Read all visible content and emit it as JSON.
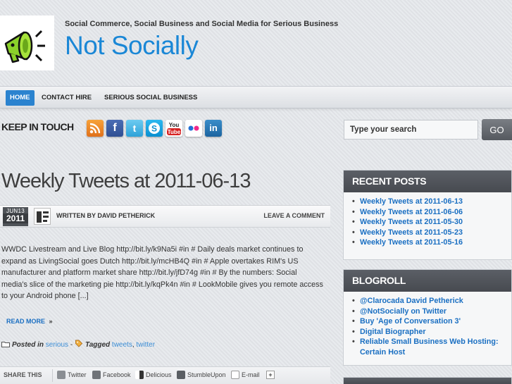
{
  "header": {
    "tagline": "Social Commerce, Social Business and Social Media for Serious Business",
    "site_title": "Not Socially"
  },
  "nav": {
    "items": [
      {
        "label": "HOME"
      },
      {
        "label": "CONTACT HIRE"
      },
      {
        "label": "SERIOUS SOCIAL BUSINESS"
      }
    ]
  },
  "keep_in_touch": {
    "label": "KEEP IN TOUCH",
    "icons": [
      "rss-icon",
      "facebook-icon",
      "twitter-icon",
      "skype-icon",
      "youtube-icon",
      "flickr-icon",
      "linkedin-icon"
    ]
  },
  "search": {
    "placeholder": "Type your search",
    "button": "GO"
  },
  "post": {
    "title": "Weekly Tweets at 2011-06-13",
    "date_md": "JUN13",
    "date_year": "2011",
    "written_by": "WRITTEN BY DAVID PETHERICK",
    "leave_comment": "LEAVE A COMMENT",
    "excerpt": "WWDC Livestream and Live Blog http://bit.ly/k9Na5i #in # Daily deals market continues to expand as LivingSocial goes Dutch http://bit.ly/mcHB4Q #in # Apple overtakes RIM's US manufacturer and platform market share http://bit.ly/jfD74g #in # By the numbers: Social media's slice of the marketing pie http://bit.ly/kqPk4n #in # LookMobile gives you remote access to your Android phone [...]",
    "read_more": "READ MORE",
    "read_more_arrow": "»",
    "posted_in_label": "Posted in",
    "category": "serious",
    "dash": "-",
    "tagged_label": "Tagged",
    "tag1": "tweets",
    "comma": ",",
    "tag2": "twitter"
  },
  "share": {
    "label": "SHARE THIS",
    "items": [
      "Twitter",
      "Facebook",
      "Delicious",
      "StumbleUpon",
      "E-mail"
    ],
    "plus": "+"
  },
  "recent_posts": {
    "title": "RECENT POSTS",
    "items": [
      "Weekly Tweets at 2011-06-13",
      "Weekly Tweets at 2011-06-06",
      "Weekly Tweets at 2011-05-30",
      "Weekly Tweets at 2011-05-23",
      "Weekly Tweets at 2011-05-16"
    ]
  },
  "blogroll": {
    "title": "BLOGROLL",
    "items": [
      "@Clarocada David Petherick",
      "@NotSocially on Twitter",
      "Buy 'Age of Conversation 3'",
      "Digital Biographer",
      "Reliable Small Business Web Hosting: Certain Host"
    ]
  },
  "colors": {
    "accent": "#2b83cf",
    "title_blue": "#1a87d6",
    "widget_header": "#4f5358",
    "logo_green": "#8bd12a"
  }
}
